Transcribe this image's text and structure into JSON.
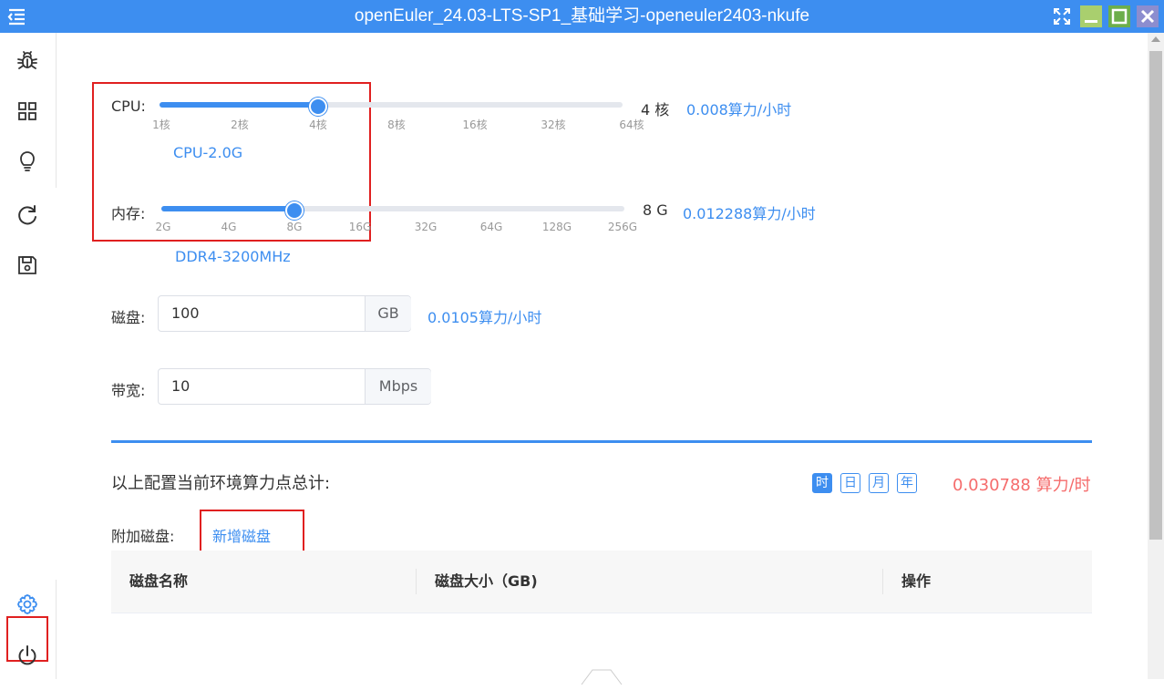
{
  "window": {
    "title": "openEuler_24.03-LTS-SP1_基础学习-openeuler2403-nkufe"
  },
  "sidebar": {
    "icons": [
      "menu-icon",
      "bug-icon",
      "grid-icon",
      "lightbulb-icon",
      "refresh-icon",
      "save-icon",
      "gear-icon",
      "power-icon"
    ]
  },
  "cpu": {
    "label": "CPU:",
    "ticks": [
      "1核",
      "2核",
      "4核",
      "8核",
      "16核",
      "32核",
      "64核"
    ],
    "selected_index": 2,
    "value": "4 核",
    "price": "0.008算力/小时",
    "model": "CPU-2.0G"
  },
  "memory": {
    "label": "内存:",
    "ticks": [
      "2G",
      "4G",
      "8G",
      "16G",
      "32G",
      "64G",
      "128G",
      "256G"
    ],
    "selected_index": 2,
    "value": "8 G",
    "price": "0.012288算力/小时",
    "model": "DDR4-3200MHz"
  },
  "disk": {
    "label": "磁盘:",
    "value": "100",
    "unit": "GB",
    "price": "0.0105算力/小时"
  },
  "bandwidth": {
    "label": "带宽:",
    "value": "10",
    "unit": "Mbps"
  },
  "summary": {
    "label": "以上配置当前环境算力点总计:",
    "periods": [
      "时",
      "日",
      "月",
      "年"
    ],
    "active_period": "时",
    "total": "0.030788 算力/时"
  },
  "extra_disk": {
    "label": "附加磁盘:",
    "add_link": "新增磁盘"
  },
  "table": {
    "columns": [
      "磁盘名称",
      "磁盘大小（GB)",
      "操作"
    ]
  },
  "colors": {
    "accent": "#3d8ef0",
    "total_red": "#f56c6c",
    "highlight_box": "#e02020"
  }
}
